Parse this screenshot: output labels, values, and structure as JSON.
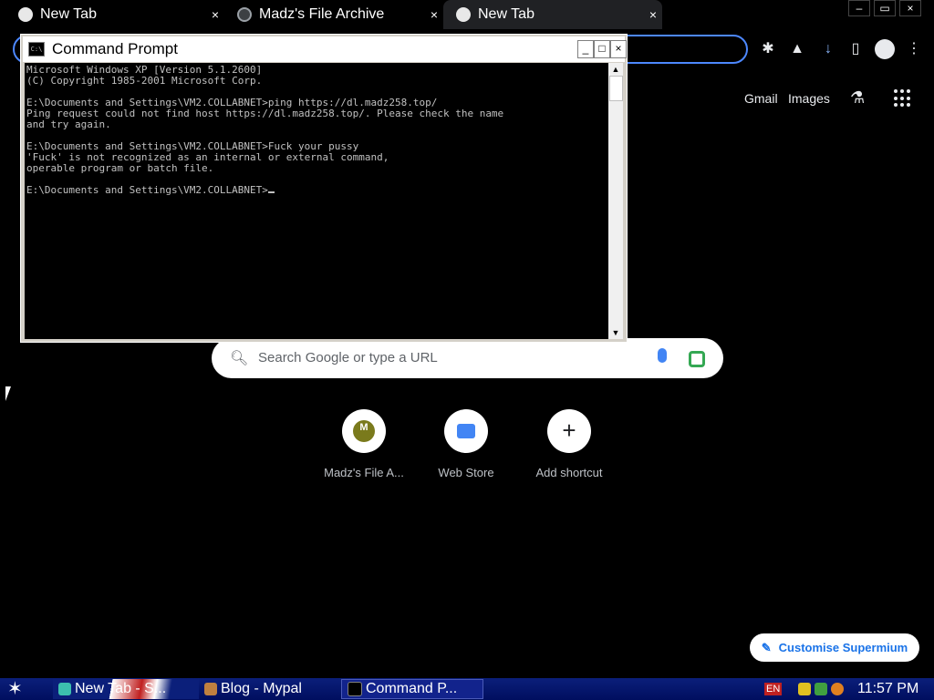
{
  "browser": {
    "tabs": [
      {
        "title": "New Tab",
        "close": "×"
      },
      {
        "title": "Madz's File Archive",
        "close": "×"
      },
      {
        "title": "New Tab",
        "close": "×"
      }
    ],
    "window_controls": [
      "–",
      "▭",
      "×"
    ]
  },
  "ntp": {
    "links": [
      "Gmail",
      "Images"
    ],
    "search_placeholder": "Search Google or type a URL",
    "shortcuts": [
      {
        "label": "Madz's File A...",
        "logo": "M"
      },
      {
        "label": "Web Store"
      },
      {
        "label": "Add shortcut",
        "icon": "+"
      }
    ],
    "customise_label": "Customise Supermium"
  },
  "cmd": {
    "title": "Command Prompt",
    "buttons": [
      "_",
      "□",
      "×"
    ],
    "lines": "Microsoft Windows XP [Version 5.1.2600]\n(C) Copyright 1985-2001 Microsoft Corp.\n\nE:\\Documents and Settings\\VM2.COLLABNET>ping https://dl.madz258.top/\nPing request could not find host https://dl.madz258.top/. Please check the name\nand try again.\n\nE:\\Documents and Settings\\VM2.COLLABNET>Fuck your pussy\n'Fuck' is not recognized as an internal or external command,\noperable program or batch file.\n\nE:\\Documents and Settings\\VM2.COLLABNET>"
  },
  "taskbar": {
    "tasks": [
      "New Tab - S...",
      "Blog - Mypal",
      "Command P..."
    ],
    "lang": "EN",
    "clock": "11:57 PM"
  }
}
